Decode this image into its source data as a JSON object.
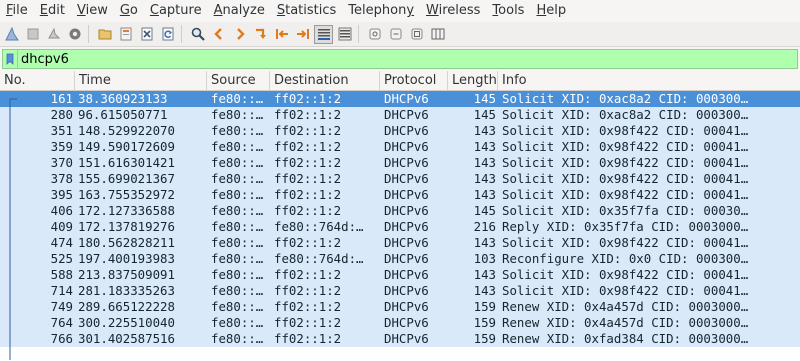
{
  "menu": [
    {
      "label": "File",
      "u": "F",
      "rest": "ile"
    },
    {
      "label": "Edit",
      "u": "E",
      "rest": "dit"
    },
    {
      "label": "View",
      "u": "V",
      "rest": "iew"
    },
    {
      "label": "Go",
      "u": "G",
      "rest": "o"
    },
    {
      "label": "Capture",
      "u": "C",
      "rest": "apture"
    },
    {
      "label": "Analyze",
      "u": "A",
      "rest": "nalyze"
    },
    {
      "label": "Statistics",
      "u": "S",
      "rest": "tatistics"
    },
    {
      "label": "Telephony",
      "u": "y",
      "pre": "Telephon",
      "rest": ""
    },
    {
      "label": "Wireless",
      "u": "W",
      "rest": "ireless"
    },
    {
      "label": "Tools",
      "u": "T",
      "rest": "ools"
    },
    {
      "label": "Help",
      "u": "H",
      "rest": "elp"
    }
  ],
  "filter": {
    "value": "dhcpv6",
    "background_color": "#afffaf"
  },
  "columns": {
    "no": "No.",
    "time": "Time",
    "source": "Source",
    "destination": "Destination",
    "protocol": "Protocol",
    "length": "Length",
    "info": "Info"
  },
  "packets": [
    {
      "no": "161",
      "time": "38.360923133",
      "source": "fe80::…",
      "destination": "ff02::1:2",
      "protocol": "DHCPv6",
      "length": "145",
      "info": "Solicit XID: 0xac8a2 CID: 000300…",
      "selected": true
    },
    {
      "no": "280",
      "time": "96.615050771",
      "source": "fe80::…",
      "destination": "ff02::1:2",
      "protocol": "DHCPv6",
      "length": "145",
      "info": "Solicit XID: 0xac8a2 CID: 000300…"
    },
    {
      "no": "351",
      "time": "148.529922070",
      "source": "fe80::…",
      "destination": "ff02::1:2",
      "protocol": "DHCPv6",
      "length": "143",
      "info": "Solicit XID: 0x98f422 CID: 00041…"
    },
    {
      "no": "359",
      "time": "149.590172609",
      "source": "fe80::…",
      "destination": "ff02::1:2",
      "protocol": "DHCPv6",
      "length": "143",
      "info": "Solicit XID: 0x98f422 CID: 00041…"
    },
    {
      "no": "370",
      "time": "151.616301421",
      "source": "fe80::…",
      "destination": "ff02::1:2",
      "protocol": "DHCPv6",
      "length": "143",
      "info": "Solicit XID: 0x98f422 CID: 00041…"
    },
    {
      "no": "378",
      "time": "155.699021367",
      "source": "fe80::…",
      "destination": "ff02::1:2",
      "protocol": "DHCPv6",
      "length": "143",
      "info": "Solicit XID: 0x98f422 CID: 00041…"
    },
    {
      "no": "395",
      "time": "163.755352972",
      "source": "fe80::…",
      "destination": "ff02::1:2",
      "protocol": "DHCPv6",
      "length": "143",
      "info": "Solicit XID: 0x98f422 CID: 00041…"
    },
    {
      "no": "406",
      "time": "172.127336588",
      "source": "fe80::…",
      "destination": "ff02::1:2",
      "protocol": "DHCPv6",
      "length": "145",
      "info": "Solicit XID: 0x35f7fa CID: 00030…"
    },
    {
      "no": "409",
      "time": "172.137819276",
      "source": "fe80::…",
      "destination": "fe80::764d:…",
      "protocol": "DHCPv6",
      "length": "216",
      "info": "Reply XID: 0x35f7fa CID: 0003000…"
    },
    {
      "no": "474",
      "time": "180.562828211",
      "source": "fe80::…",
      "destination": "ff02::1:2",
      "protocol": "DHCPv6",
      "length": "143",
      "info": "Solicit XID: 0x98f422 CID: 00041…"
    },
    {
      "no": "525",
      "time": "197.400193983",
      "source": "fe80::…",
      "destination": "fe80::764d:…",
      "protocol": "DHCPv6",
      "length": "103",
      "info": "Reconfigure XID: 0x0 CID: 000300…"
    },
    {
      "no": "588",
      "time": "213.837509091",
      "source": "fe80::…",
      "destination": "ff02::1:2",
      "protocol": "DHCPv6",
      "length": "143",
      "info": "Solicit XID: 0x98f422 CID: 00041…"
    },
    {
      "no": "714",
      "time": "281.183335263",
      "source": "fe80::…",
      "destination": "ff02::1:2",
      "protocol": "DHCPv6",
      "length": "143",
      "info": "Solicit XID: 0x98f422 CID: 00041…"
    },
    {
      "no": "749",
      "time": "289.665122228",
      "source": "fe80::…",
      "destination": "ff02::1:2",
      "protocol": "DHCPv6",
      "length": "159",
      "info": "Renew XID: 0x4a457d CID: 0003000…"
    },
    {
      "no": "764",
      "time": "300.225510040",
      "source": "fe80::…",
      "destination": "ff02::1:2",
      "protocol": "DHCPv6",
      "length": "159",
      "info": "Renew XID: 0x4a457d CID: 0003000…"
    },
    {
      "no": "766",
      "time": "301.402587516",
      "source": "fe80::…",
      "destination": "ff02::1:2",
      "protocol": "DHCPv6",
      "length": "159",
      "info": "Renew XID: 0xfad384 CID: 0003000…"
    }
  ],
  "colors": {
    "row_background": "#dae9fa",
    "row_selected": "#4a90d9",
    "filter_valid": "#afffaf"
  },
  "toolbar_icons": [
    "shark-fin-start-icon",
    "stop-capture-icon",
    "restart-capture-icon",
    "capture-options-icon",
    "open-file-icon",
    "save-file-icon",
    "close-file-icon",
    "reload-file-icon",
    "find-packet-icon",
    "go-back-icon",
    "go-forward-icon",
    "go-to-packet-icon",
    "go-first-icon",
    "go-last-icon",
    "auto-scroll-icon",
    "colorize-icon",
    "zoom-in-icon",
    "zoom-out-icon",
    "normal-size-icon",
    "resize-columns-icon"
  ]
}
